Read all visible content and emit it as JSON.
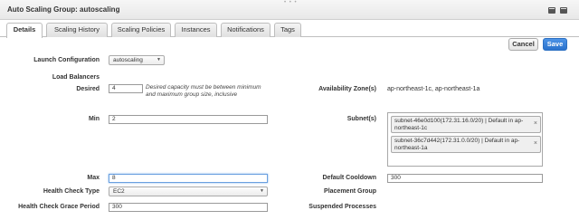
{
  "window": {
    "title": "Auto Scaling Group: autoscaling",
    "grip": "• • •"
  },
  "tabs": [
    {
      "label": "Details",
      "active": true
    },
    {
      "label": "Scaling History"
    },
    {
      "label": "Scaling Policies"
    },
    {
      "label": "Instances"
    },
    {
      "label": "Notifications"
    },
    {
      "label": "Tags"
    }
  ],
  "actions": {
    "cancel": "Cancel",
    "save": "Save"
  },
  "form": {
    "launch_configuration": {
      "label": "Launch Configuration",
      "value": "autoscaling"
    },
    "load_balancers": {
      "label": "Load Balancers"
    },
    "desired": {
      "label": "Desired",
      "value": "4",
      "hint": "Desired capacity must be between minimum and maximum group size, inclusive"
    },
    "min": {
      "label": "Min",
      "value": "2"
    },
    "max": {
      "label": "Max",
      "value": "8"
    },
    "health_check_type": {
      "label": "Health Check Type",
      "value": "EC2"
    },
    "health_check_grace": {
      "label": "Health Check Grace Period",
      "value": "300"
    },
    "availability_zones": {
      "label": "Availability Zone(s)",
      "value": "ap-northeast-1c, ap-northeast-1a"
    },
    "subnets": {
      "label": "Subnet(s)",
      "items": [
        "subnet-46e0d100(172.31.16.0/20) | Default in ap-northeast-1c",
        "subnet-36c7d442(172.31.0.0/20) | Default in ap-northeast-1a"
      ],
      "remove": "×"
    },
    "default_cooldown": {
      "label": "Default Cooldown",
      "value": "300"
    },
    "placement_group": {
      "label": "Placement Group"
    },
    "suspended_processes": {
      "label": "Suspended Processes"
    }
  },
  "icons": {
    "caret": "▼"
  }
}
